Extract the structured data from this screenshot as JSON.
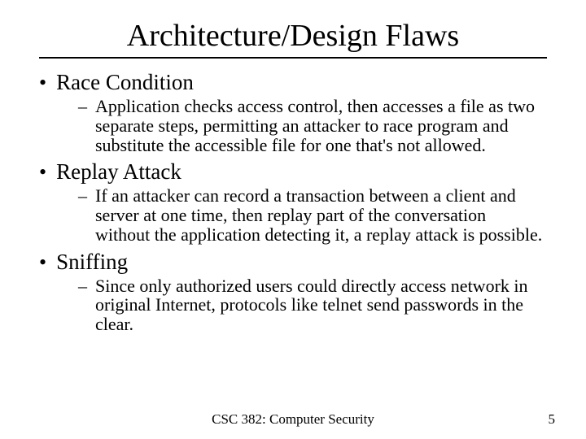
{
  "title": "Architecture/Design Flaws",
  "bullets": [
    {
      "label": "Race Condition",
      "sub": "Application checks access control, then accesses a file as two separate steps, permitting an attacker to race program and substitute the accessible file for one that's not allowed."
    },
    {
      "label": "Replay Attack",
      "sub": "If an attacker can record a transaction between a client and server at one time, then replay part of the conversation without the application detecting it, a replay attack is possible."
    },
    {
      "label": "Sniffing",
      "sub": "Since only authorized users could directly access network in original Internet, protocols like telnet send passwords in the clear."
    }
  ],
  "footer": "CSC 382: Computer Security",
  "page": "5"
}
